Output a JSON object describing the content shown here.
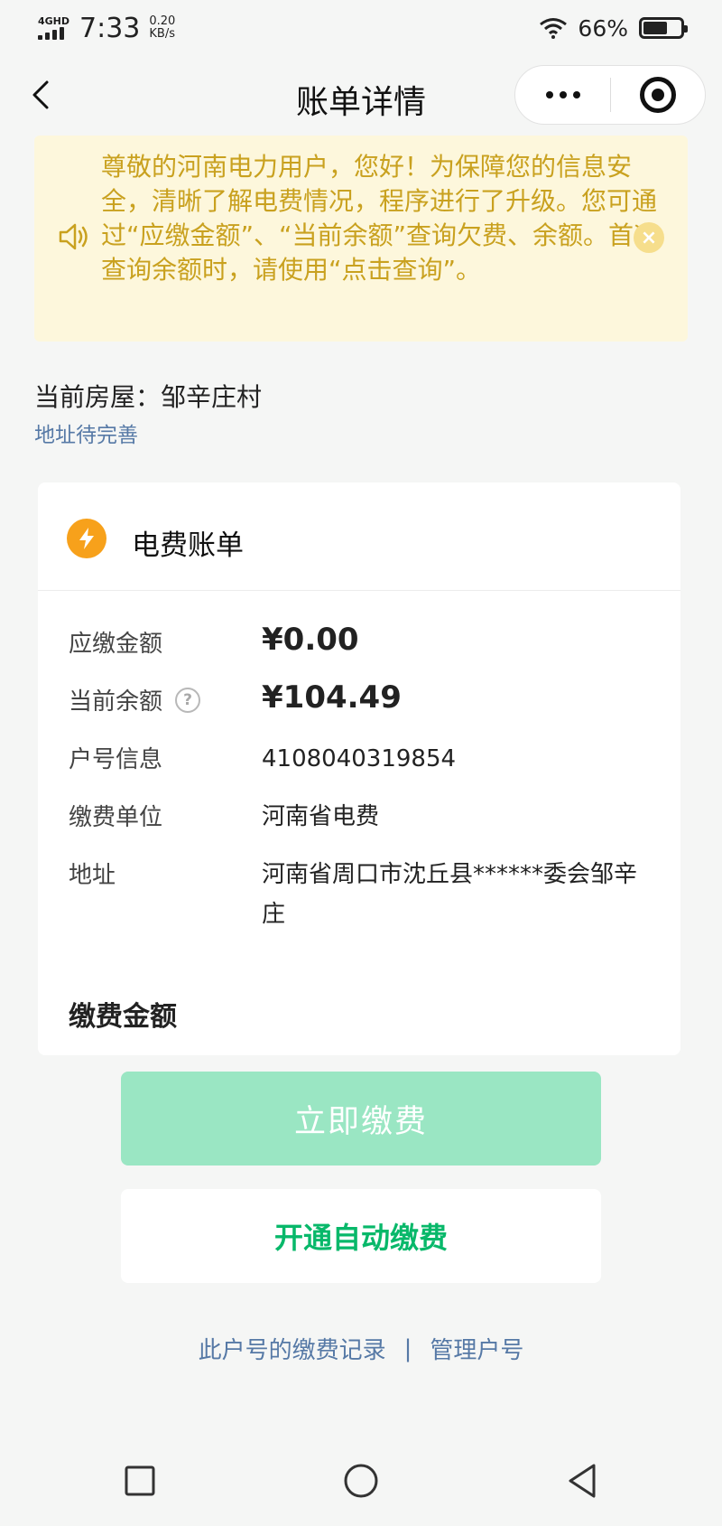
{
  "status_bar": {
    "network": "4GHD",
    "time": "7:33",
    "speed_value": "0.20",
    "speed_unit": "KB/s",
    "battery_percent": "66%",
    "battery_level": 0.66
  },
  "nav": {
    "title": "账单详情"
  },
  "notice": {
    "text": "尊敬的河南电力用户，您好！为保障您的信息安全，清晰了解电费情况，程序进行了升级。您可通过“应缴金额”、“当前余额”查询欠费、余额。首次查询余额时，请使用“点击查询”。",
    "close_symbol": "×",
    "color": "#c9a11f"
  },
  "house": {
    "label": "当前房屋：",
    "name": "邹辛庄村",
    "address_status": "地址待完善"
  },
  "bill": {
    "title": "电费账单",
    "rows": [
      {
        "label": "应缴金额",
        "value": "¥0.00"
      },
      {
        "label": "当前余额",
        "value": "¥104.49"
      },
      {
        "label": "户号信息",
        "value": "4108040319854"
      },
      {
        "label": "缴费单位",
        "value": "河南省电费"
      },
      {
        "label": "地址",
        "value": "河南省周口市沈丘县******委会邹辛庄"
      }
    ],
    "help_symbol": "?",
    "pay_amount_title": "缴费金额"
  },
  "actions": {
    "pay_now": "立即缴费",
    "auto_pay": "开通自动缴费",
    "pay_record_link": "此户号的缴费记录",
    "separator": "|",
    "manage_link": "管理户号"
  },
  "colors": {
    "accent_green": "#08b86a",
    "disabled_green": "#9ae6c3",
    "link_blue": "#5679a6",
    "bolt_orange": "#f7a11b"
  }
}
